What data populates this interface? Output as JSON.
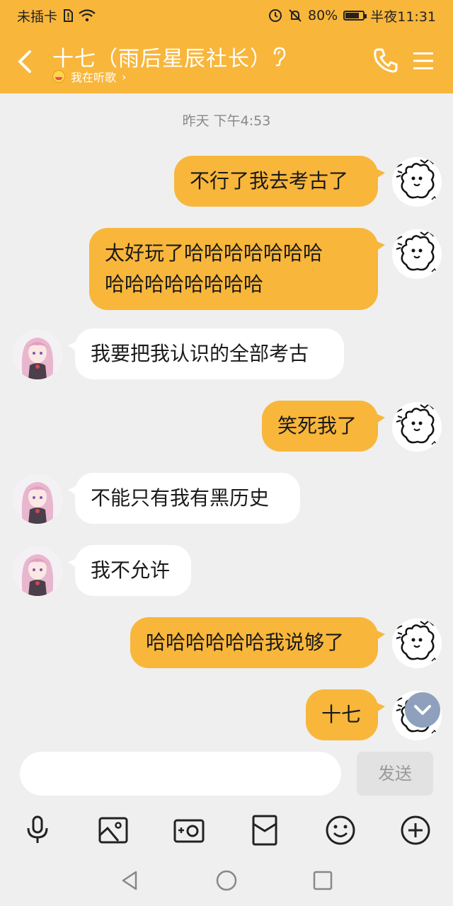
{
  "status": {
    "carrier": "未插卡",
    "battery": "80%",
    "battery_level": 0.8,
    "time": "半夜11:31"
  },
  "header": {
    "contact_name": "十七（雨后星辰社长）",
    "status_text": "我在听歌",
    "status_chevron": "›"
  },
  "chat": {
    "timestamp": "昨天 下午4:53",
    "messages": [
      {
        "side": "out",
        "lines": [
          "不行了我去考古了"
        ]
      },
      {
        "side": "out",
        "lines": [
          "太好玩了哈哈哈哈哈哈哈",
          "哈哈哈哈哈哈哈哈"
        ]
      },
      {
        "side": "in",
        "lines": [
          "我要把我认识的全部考古"
        ]
      },
      {
        "side": "out",
        "lines": [
          "笑死我了"
        ]
      },
      {
        "side": "in",
        "lines": [
          "不能只有我有黑历史"
        ]
      },
      {
        "side": "in",
        "lines": [
          "我不允许"
        ]
      },
      {
        "side": "out",
        "lines": [
          "哈哈哈哈哈哈我说够了"
        ]
      },
      {
        "side": "out",
        "lines": [
          "十七"
        ]
      }
    ]
  },
  "composer": {
    "placeholder": "",
    "send_label": "发送"
  },
  "colors": {
    "accent": "#f8b63b",
    "background": "#efefef",
    "bubble_in": "#ffffff"
  },
  "icons": {
    "toolbar": [
      "microphone-icon",
      "image-icon",
      "camera-icon",
      "red-packet-icon",
      "emoji-icon",
      "plus-icon"
    ],
    "nav": [
      "back-triangle-icon",
      "home-circle-icon",
      "recent-square-icon"
    ]
  }
}
